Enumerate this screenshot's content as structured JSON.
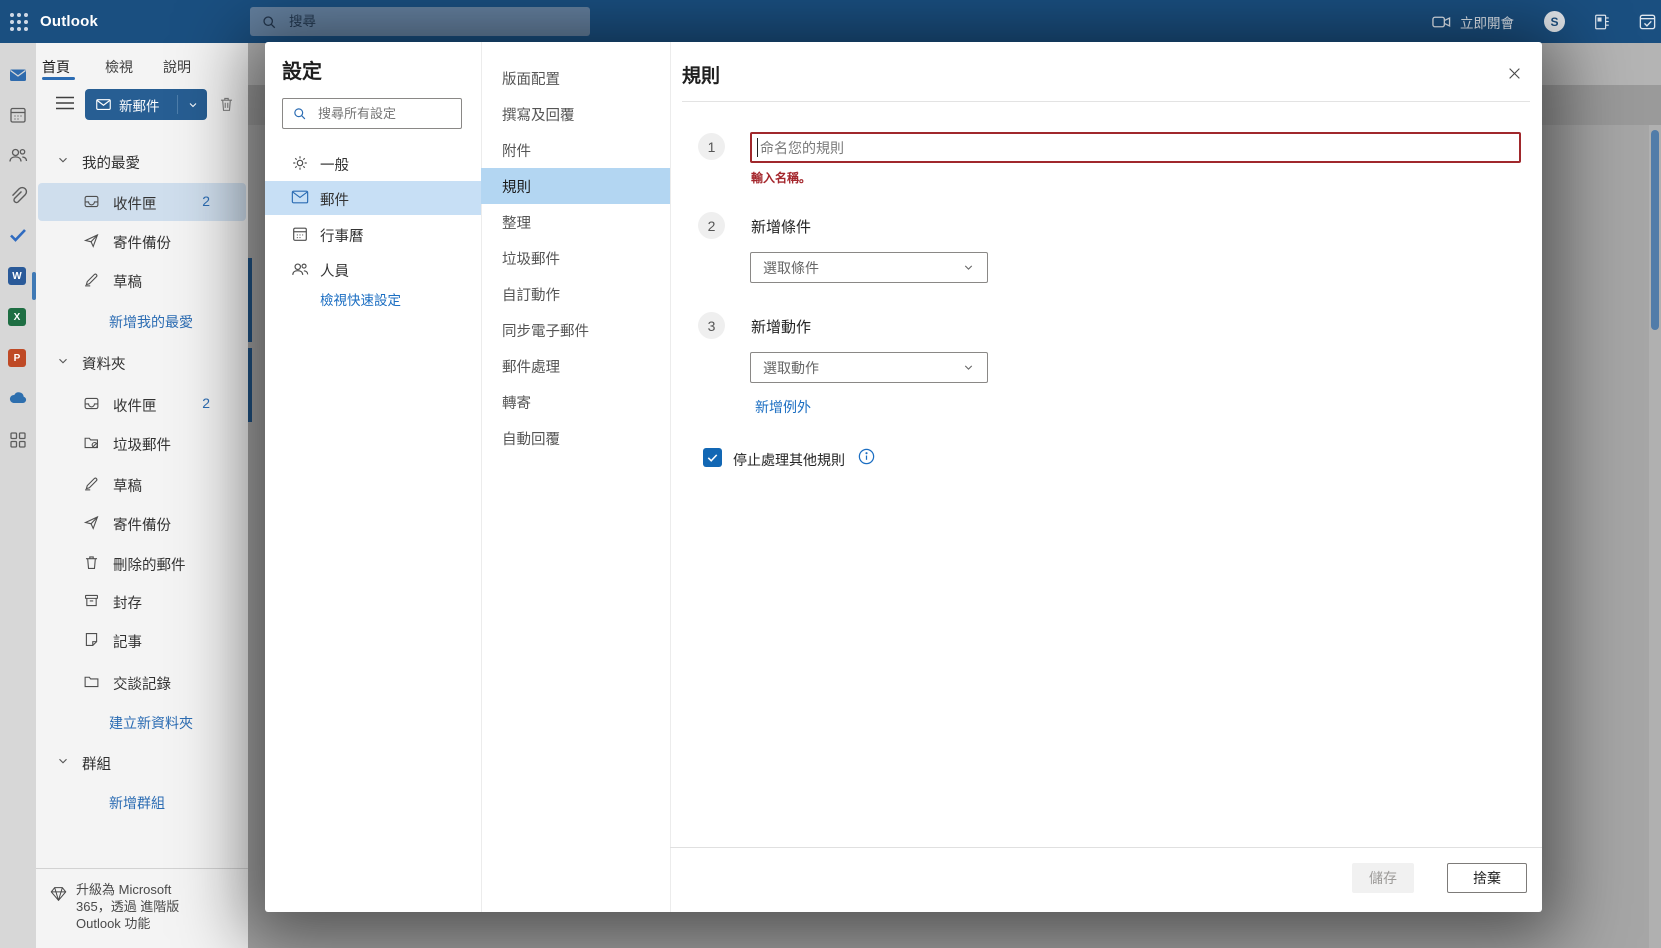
{
  "colors": {
    "topbar_bg": "#1a4f80",
    "accent_blue": "#106ebe",
    "selected_item_bg": "#b3d6f2",
    "error_red": "#a4262c",
    "new_mail_button_bg": "#275e93"
  },
  "topbar": {
    "app_title": "Outlook",
    "search_placeholder": "搜尋",
    "meet_now_label": "立即開會",
    "skype_initial": "S"
  },
  "ribbon": {
    "tabs": [
      {
        "label": "首頁"
      },
      {
        "label": "檢視"
      },
      {
        "label": "說明"
      }
    ],
    "new_mail_label": "新郵件"
  },
  "sidebar": {
    "favorites_header": "我的最愛",
    "favorites": [
      {
        "label": "收件匣",
        "badge": "2",
        "icon": "inbox-icon"
      },
      {
        "label": "寄件備份",
        "icon": "sent-icon"
      },
      {
        "label": "草稿",
        "icon": "draft-icon"
      }
    ],
    "add_favorite_link": "新增我的最愛",
    "folders_header": "資料夾",
    "folders": [
      {
        "label": "收件匣",
        "badge": "2",
        "icon": "inbox-icon"
      },
      {
        "label": "垃圾郵件",
        "icon": "junk-folder-icon"
      },
      {
        "label": "草稿",
        "icon": "draft-icon"
      },
      {
        "label": "寄件備份",
        "icon": "sent-icon"
      },
      {
        "label": "刪除的郵件",
        "icon": "trash-icon"
      },
      {
        "label": "封存",
        "icon": "archive-icon"
      },
      {
        "label": "記事",
        "icon": "note-icon"
      },
      {
        "label": "交談記錄",
        "icon": "folder-icon"
      }
    ],
    "create_folder_link": "建立新資料夾",
    "groups_header": "群組",
    "add_group_link": "新增群組",
    "upgrade_lines": [
      "升級為 Microsoft",
      "365，透過 進階版",
      "Outlook 功能"
    ]
  },
  "settings": {
    "title": "設定",
    "search_placeholder": "搜尋所有設定",
    "categories": [
      {
        "label": "一般",
        "icon": "gear-icon"
      },
      {
        "label": "郵件",
        "icon": "mail-icon"
      },
      {
        "label": "行事曆",
        "icon": "calendar-icon"
      },
      {
        "label": "人員",
        "icon": "people-icon"
      }
    ],
    "quick_settings_link": "檢視快速設定",
    "sections": [
      "版面配置",
      "撰寫及回覆",
      "附件",
      "規則",
      "整理",
      "垃圾郵件",
      "自訂動作",
      "同步電子郵件",
      "郵件處理",
      "轉寄",
      "自動回覆"
    ]
  },
  "rules": {
    "title": "規則",
    "step1_number": "1",
    "step2_number": "2",
    "step3_number": "3",
    "name_placeholder": "命名您的規則",
    "name_error": "輸入名稱。",
    "add_condition_label": "新增條件",
    "condition_placeholder": "選取條件",
    "add_action_label": "新增動作",
    "action_placeholder": "選取動作",
    "add_exception_link": "新增例外",
    "stop_processing_label": "停止處理其他規則",
    "save_label": "儲存",
    "discard_label": "捨棄"
  }
}
